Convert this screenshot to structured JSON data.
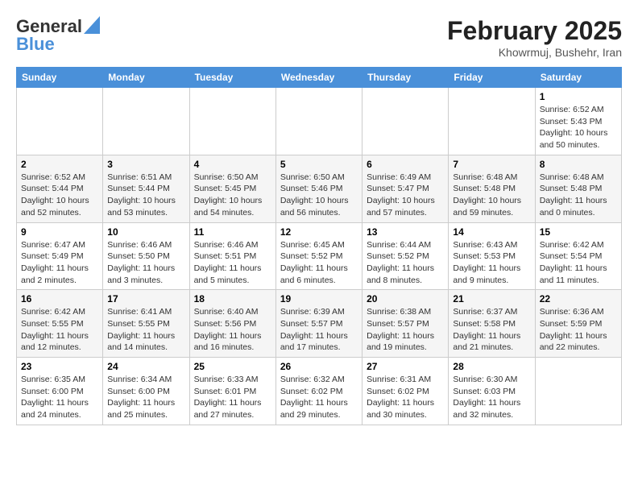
{
  "header": {
    "logo_line1": "General",
    "logo_line2": "Blue",
    "month_title": "February 2025",
    "subtitle": "Khowrmuj, Bushehr, Iran"
  },
  "calendar": {
    "days_of_week": [
      "Sunday",
      "Monday",
      "Tuesday",
      "Wednesday",
      "Thursday",
      "Friday",
      "Saturday"
    ],
    "weeks": [
      [
        {
          "day": "",
          "info": ""
        },
        {
          "day": "",
          "info": ""
        },
        {
          "day": "",
          "info": ""
        },
        {
          "day": "",
          "info": ""
        },
        {
          "day": "",
          "info": ""
        },
        {
          "day": "",
          "info": ""
        },
        {
          "day": "1",
          "info": "Sunrise: 6:52 AM\nSunset: 5:43 PM\nDaylight: 10 hours\nand 50 minutes."
        }
      ],
      [
        {
          "day": "2",
          "info": "Sunrise: 6:52 AM\nSunset: 5:44 PM\nDaylight: 10 hours\nand 52 minutes."
        },
        {
          "day": "3",
          "info": "Sunrise: 6:51 AM\nSunset: 5:44 PM\nDaylight: 10 hours\nand 53 minutes."
        },
        {
          "day": "4",
          "info": "Sunrise: 6:50 AM\nSunset: 5:45 PM\nDaylight: 10 hours\nand 54 minutes."
        },
        {
          "day": "5",
          "info": "Sunrise: 6:50 AM\nSunset: 5:46 PM\nDaylight: 10 hours\nand 56 minutes."
        },
        {
          "day": "6",
          "info": "Sunrise: 6:49 AM\nSunset: 5:47 PM\nDaylight: 10 hours\nand 57 minutes."
        },
        {
          "day": "7",
          "info": "Sunrise: 6:48 AM\nSunset: 5:48 PM\nDaylight: 10 hours\nand 59 minutes."
        },
        {
          "day": "8",
          "info": "Sunrise: 6:48 AM\nSunset: 5:48 PM\nDaylight: 11 hours\nand 0 minutes."
        }
      ],
      [
        {
          "day": "9",
          "info": "Sunrise: 6:47 AM\nSunset: 5:49 PM\nDaylight: 11 hours\nand 2 minutes."
        },
        {
          "day": "10",
          "info": "Sunrise: 6:46 AM\nSunset: 5:50 PM\nDaylight: 11 hours\nand 3 minutes."
        },
        {
          "day": "11",
          "info": "Sunrise: 6:46 AM\nSunset: 5:51 PM\nDaylight: 11 hours\nand 5 minutes."
        },
        {
          "day": "12",
          "info": "Sunrise: 6:45 AM\nSunset: 5:52 PM\nDaylight: 11 hours\nand 6 minutes."
        },
        {
          "day": "13",
          "info": "Sunrise: 6:44 AM\nSunset: 5:52 PM\nDaylight: 11 hours\nand 8 minutes."
        },
        {
          "day": "14",
          "info": "Sunrise: 6:43 AM\nSunset: 5:53 PM\nDaylight: 11 hours\nand 9 minutes."
        },
        {
          "day": "15",
          "info": "Sunrise: 6:42 AM\nSunset: 5:54 PM\nDaylight: 11 hours\nand 11 minutes."
        }
      ],
      [
        {
          "day": "16",
          "info": "Sunrise: 6:42 AM\nSunset: 5:55 PM\nDaylight: 11 hours\nand 12 minutes."
        },
        {
          "day": "17",
          "info": "Sunrise: 6:41 AM\nSunset: 5:55 PM\nDaylight: 11 hours\nand 14 minutes."
        },
        {
          "day": "18",
          "info": "Sunrise: 6:40 AM\nSunset: 5:56 PM\nDaylight: 11 hours\nand 16 minutes."
        },
        {
          "day": "19",
          "info": "Sunrise: 6:39 AM\nSunset: 5:57 PM\nDaylight: 11 hours\nand 17 minutes."
        },
        {
          "day": "20",
          "info": "Sunrise: 6:38 AM\nSunset: 5:57 PM\nDaylight: 11 hours\nand 19 minutes."
        },
        {
          "day": "21",
          "info": "Sunrise: 6:37 AM\nSunset: 5:58 PM\nDaylight: 11 hours\nand 21 minutes."
        },
        {
          "day": "22",
          "info": "Sunrise: 6:36 AM\nSunset: 5:59 PM\nDaylight: 11 hours\nand 22 minutes."
        }
      ],
      [
        {
          "day": "23",
          "info": "Sunrise: 6:35 AM\nSunset: 6:00 PM\nDaylight: 11 hours\nand 24 minutes."
        },
        {
          "day": "24",
          "info": "Sunrise: 6:34 AM\nSunset: 6:00 PM\nDaylight: 11 hours\nand 25 minutes."
        },
        {
          "day": "25",
          "info": "Sunrise: 6:33 AM\nSunset: 6:01 PM\nDaylight: 11 hours\nand 27 minutes."
        },
        {
          "day": "26",
          "info": "Sunrise: 6:32 AM\nSunset: 6:02 PM\nDaylight: 11 hours\nand 29 minutes."
        },
        {
          "day": "27",
          "info": "Sunrise: 6:31 AM\nSunset: 6:02 PM\nDaylight: 11 hours\nand 30 minutes."
        },
        {
          "day": "28",
          "info": "Sunrise: 6:30 AM\nSunset: 6:03 PM\nDaylight: 11 hours\nand 32 minutes."
        },
        {
          "day": "",
          "info": ""
        }
      ]
    ]
  }
}
